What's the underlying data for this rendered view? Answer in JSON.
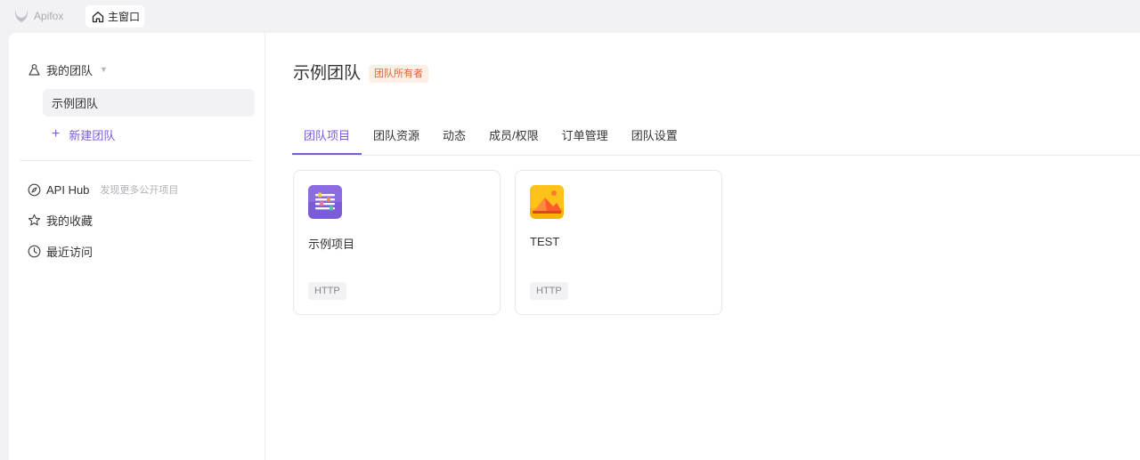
{
  "app": {
    "brand": "Apifox",
    "home_tab": "主窗口"
  },
  "sidebar": {
    "team_switch": "我的团队",
    "teams": [
      "示例团队"
    ],
    "new_team": "新建团队",
    "api_hub": "API Hub",
    "api_hub_hint": "发现更多公开项目",
    "favorites": "我的收藏",
    "recent": "最近访问"
  },
  "main": {
    "title": "示例团队",
    "owner_badge": "团队所有者",
    "tabs": [
      {
        "label": "团队项目",
        "active": true
      },
      {
        "label": "团队资源",
        "active": false
      },
      {
        "label": "动态",
        "active": false
      },
      {
        "label": "成员/权限",
        "active": false
      },
      {
        "label": "订单管理",
        "active": false
      },
      {
        "label": "团队设置",
        "active": false
      }
    ],
    "projects": [
      {
        "name": "示例项目",
        "type": "HTTP",
        "icon": "sliders-icon",
        "color": "#7b5cd6"
      },
      {
        "name": "TEST",
        "type": "HTTP",
        "icon": "landscape-icon",
        "color": "#f5b400"
      }
    ]
  },
  "colors": {
    "accent": "#7b5cd6",
    "badge_bg": "#fdeee6",
    "badge_text": "#d36b3c"
  }
}
